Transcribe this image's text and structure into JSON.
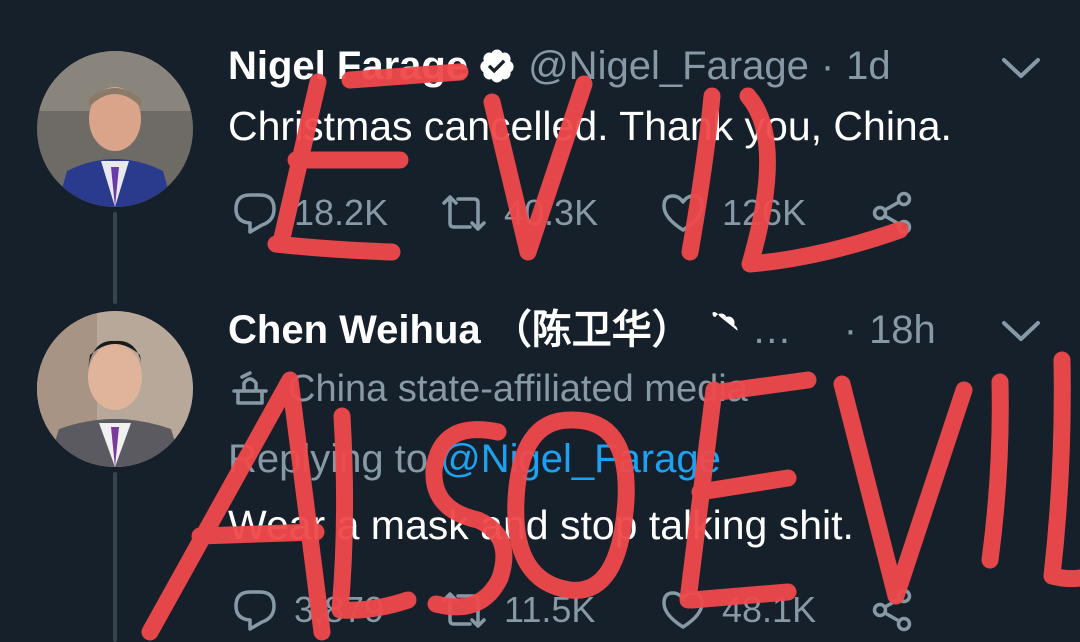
{
  "tweets": [
    {
      "name": "Nigel Farage",
      "handle": "@Nigel_Farage",
      "separator": "·",
      "time": "1d",
      "text": "Christmas cancelled. Thank you, China.",
      "replies": "18.2K",
      "retweets": "40.3K",
      "likes": "126K"
    },
    {
      "name": "Chen Weihua （陈卫华）",
      "ellipsis": "…",
      "separator": "·",
      "time": "18h",
      "label": "China state-affiliated media",
      "replying_prefix": "Replying to",
      "replying_to": "@Nigel_Farage",
      "text": "Wear a mask and stop talking shit.",
      "replies": "3,879",
      "retweets": "11.5K",
      "likes": "48.1K"
    }
  ],
  "annotations": {
    "top": "EVIL",
    "bottom": "ALSO EVIL",
    "color": "#f0494b"
  },
  "icons": [
    "verified-badge-icon",
    "chevron-down-icon",
    "reply-icon",
    "retweet-icon",
    "like-icon",
    "share-icon",
    "state-media-icon"
  ],
  "colors": {
    "background": "#15202b",
    "text": "#ffffff",
    "secondary": "#8899a6",
    "link": "#1da1f2",
    "thread_line": "#38444d"
  }
}
